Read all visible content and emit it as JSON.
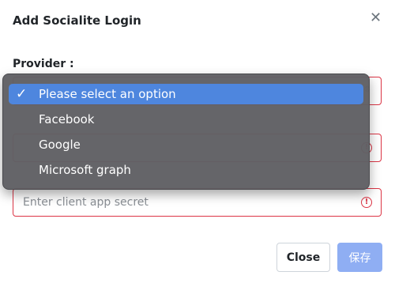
{
  "modal": {
    "title": "Add Socialite Login",
    "close_icon": "close-icon"
  },
  "form": {
    "provider_label": "Provider :",
    "client_secret_placeholder": "Enter client app secret"
  },
  "dropdown": {
    "options": [
      {
        "label": "Please select an option",
        "selected": true
      },
      {
        "label": "Facebook",
        "selected": false
      },
      {
        "label": "Google",
        "selected": false
      },
      {
        "label": "Microsoft graph",
        "selected": false
      }
    ]
  },
  "footer": {
    "close_label": "Close",
    "save_label": "保存"
  },
  "colors": {
    "error": "#dc3545",
    "selected_option": "#4e86de",
    "save_button": "#8faef3"
  }
}
